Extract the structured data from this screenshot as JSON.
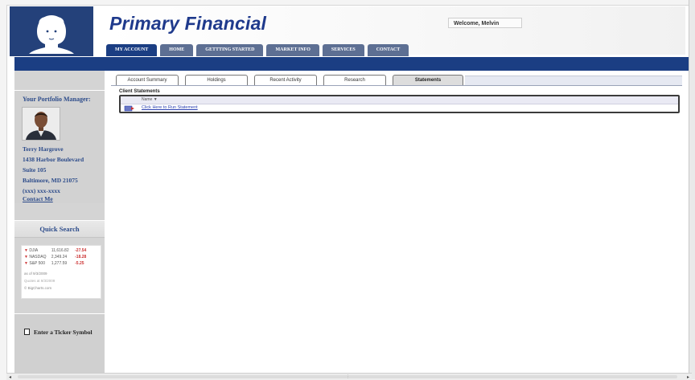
{
  "header": {
    "brand": "Primary Financial",
    "welcome": "Welcome, Melvin",
    "logo_icon": "portrait-logo-icon"
  },
  "main_tabs": [
    {
      "label": "MY ACCOUNT",
      "active": true
    },
    {
      "label": "HOME",
      "active": false
    },
    {
      "label": "GETTTING STARTED",
      "active": false
    },
    {
      "label": "MARKET INFO",
      "active": false
    },
    {
      "label": "SERVICES",
      "active": false
    },
    {
      "label": "CONTACT",
      "active": false
    }
  ],
  "sub_tabs": [
    {
      "label": "Account Summary",
      "active": false
    },
    {
      "label": "Holdings",
      "active": false
    },
    {
      "label": "Recent Activity",
      "active": false
    },
    {
      "label": "Research",
      "active": false
    },
    {
      "label": "Statements",
      "active": true
    }
  ],
  "portfolio_manager": {
    "title": "Your Portfolio Manager:",
    "name": "Terry Hargrove",
    "address1": "1438 Harbor Boulevard",
    "address2": "Suite 105",
    "city": "Baltimore, MD  21075",
    "phone": "(xxx) xxx-xxxx",
    "contact": "Contact Me"
  },
  "quick_search": {
    "title": "Quick Search",
    "rows": [
      {
        "symbol": "DJIA",
        "value": "11,616.82",
        "change": "-27.54"
      },
      {
        "symbol": "NASDAQ",
        "value": "2,349.24",
        "change": "-18.28"
      },
      {
        "symbol": "S&P 500",
        "value": "1,277.59",
        "change": "-5.25"
      }
    ],
    "as_of": "as of 9/3/2009",
    "delay": "Quotes at 9/3/2009",
    "source": "© BigCharts.com",
    "ticker_label": "Enter a Ticker Symbol"
  },
  "statements": {
    "title": "Client Statements",
    "column": "Name ▼",
    "link": "Click Here to Run Statement"
  },
  "colors": {
    "brand_blue": "#1b3e83",
    "tab_gray": "#5d6f93",
    "panel_gray": "#d2d2d2",
    "negative": "#cc3333"
  }
}
